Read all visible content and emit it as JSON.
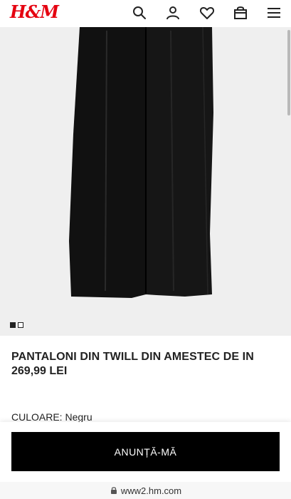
{
  "brand": {
    "logo_text": "H&M",
    "color": "#e50010"
  },
  "header": {
    "icons": [
      "search-icon",
      "account-icon",
      "favorites-heart-icon",
      "shopping-bag-icon",
      "menu-icon"
    ]
  },
  "product": {
    "title": "PANTALONI DIN TWILL DIN AMESTEC DE IN",
    "price": "269,99 LEI",
    "color_label": "CULOARE:",
    "color_value": "Negru",
    "image_count": 2,
    "active_image": 1
  },
  "actions": {
    "notify_label": "ANUNȚĂ-MĂ"
  },
  "browser": {
    "url": "www2.hm.com"
  }
}
